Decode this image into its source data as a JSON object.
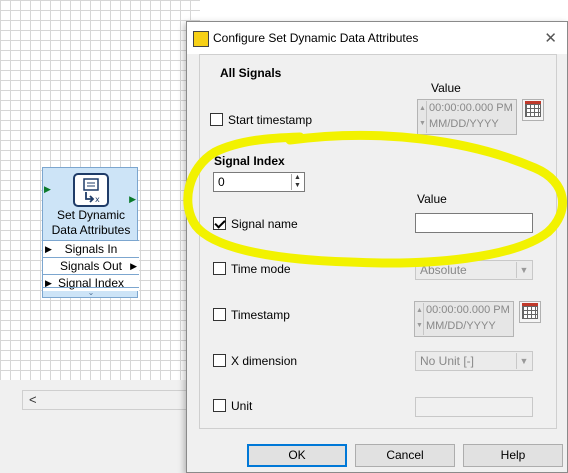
{
  "diagram": {
    "node": {
      "title_line1": "Set Dynamic",
      "title_line2": "Data Attributes",
      "terminals": [
        "Signals In",
        "Signals Out",
        "Signal Index"
      ]
    },
    "scroll_left": "<"
  },
  "dialog": {
    "title": "Configure Set Dynamic Data Attributes",
    "close_glyph": "✕",
    "all_signals_label": "All Signals",
    "value_label": "Value",
    "start_timestamp": {
      "label": "Start timestamp",
      "checked": false,
      "time": "00:00:00.000 PM",
      "date": "MM/DD/YYYY"
    },
    "signal_index_label": "Signal Index",
    "signal_index_value": "0",
    "signal_value_label": "Value",
    "signal_name": {
      "label": "Signal name",
      "checked": true,
      "value": ""
    },
    "time_mode": {
      "label": "Time mode",
      "checked": false,
      "value": "Absolute"
    },
    "timestamp": {
      "label": "Timestamp",
      "checked": false,
      "time": "00:00:00.000 PM",
      "date": "MM/DD/YYYY"
    },
    "x_dimension": {
      "label": "X dimension",
      "checked": false,
      "value": "No Unit [-]"
    },
    "unit": {
      "label": "Unit",
      "checked": false,
      "value": ""
    },
    "buttons": {
      "ok": "OK",
      "cancel": "Cancel",
      "help": "Help"
    }
  },
  "colors": {
    "highlight": "#f2f200",
    "node_fill": "#cde4f7",
    "accent": "#0078d7"
  }
}
